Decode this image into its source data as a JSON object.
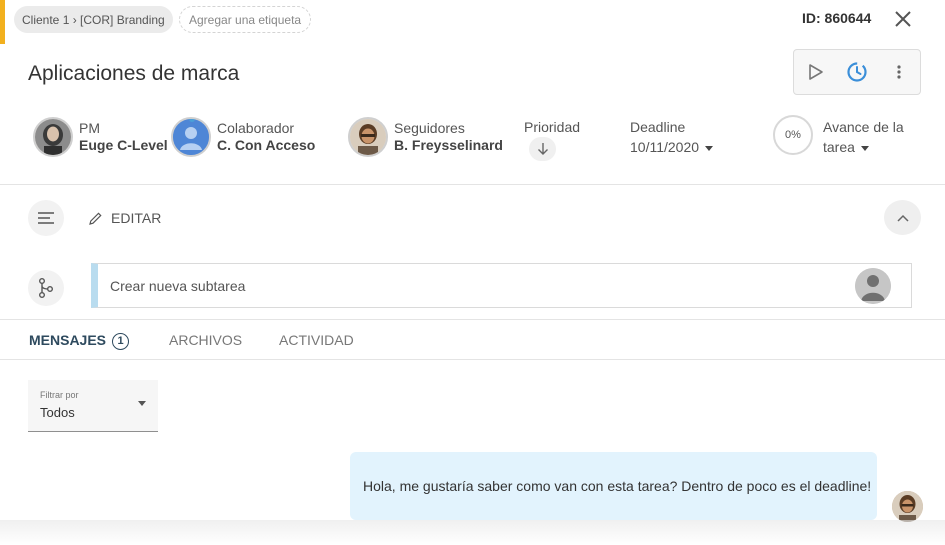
{
  "header": {
    "breadcrumb": "Cliente 1 › [COR] Branding",
    "tag_placeholder": "Agregar una etiqueta",
    "task_id": "ID: 860644"
  },
  "task": {
    "title": "Aplicaciones de marca"
  },
  "people": {
    "pm": {
      "role": "PM",
      "name": "Euge C-Level"
    },
    "collaborator": {
      "role": "Colaborador",
      "name": "C. Con Acceso"
    },
    "followers": {
      "role": "Seguidores",
      "name": "B. Freysselinard"
    }
  },
  "meta": {
    "priority_label": "Prioridad",
    "deadline_label": "Deadline",
    "deadline_value": "10/11/2020",
    "progress_value": "0%",
    "progress_label_line1": "Avance de la",
    "progress_label_line2": "tarea"
  },
  "description": {
    "edit_label": "EDITAR"
  },
  "subtask": {
    "placeholder": "Crear nueva subtarea"
  },
  "tabs": [
    {
      "label": "MENSAJES",
      "badge": "1"
    },
    {
      "label": "ARCHIVOS"
    },
    {
      "label": "ACTIVIDAD"
    }
  ],
  "filter": {
    "label": "Filtrar por",
    "value": "Todos"
  },
  "messages": [
    {
      "text": "Hola, me gustaría saber como van con esta tarea? Dentro de poco es el deadline!"
    }
  ],
  "colors": {
    "accent": "#f2b01e",
    "bubble": "#e2f3fd",
    "subtask_bar": "#b9dcef",
    "active_tab": "#2e4a5e"
  }
}
